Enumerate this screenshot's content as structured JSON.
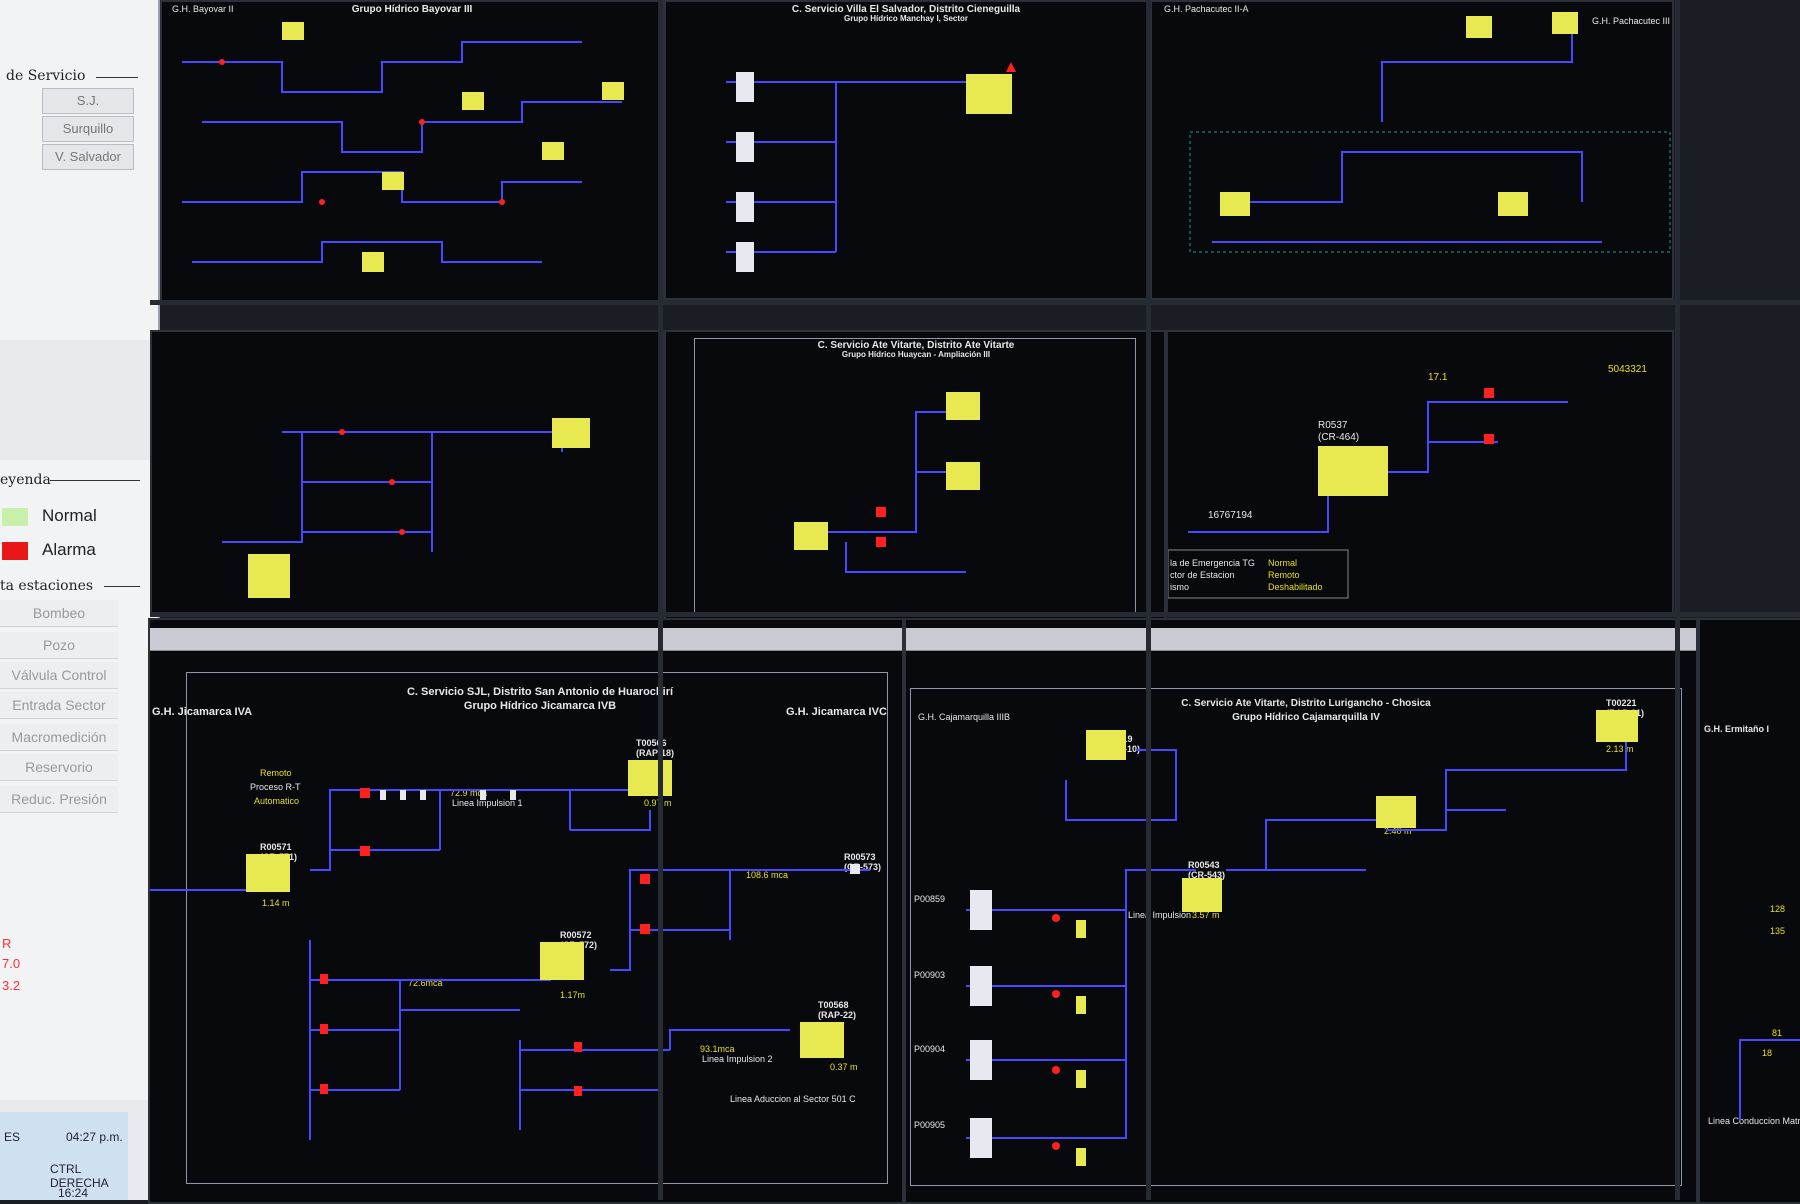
{
  "left_panel": {
    "service_title": "de Servicio",
    "service_buttons": [
      "S.J. Lurigancho",
      "Surquillo",
      "V. Salvador"
    ],
    "legend_title": "eyenda",
    "legend_items": [
      {
        "label": "Normal",
        "color": "#c8f0a8"
      },
      {
        "label": "Alarma",
        "color": "#e81818"
      }
    ],
    "stations_title": "ta estaciones",
    "stations": [
      "Bombeo",
      "Pozo",
      "Válvula Control",
      "Entrada Sector",
      "Macromedición",
      "Reservorio",
      "Reduc. Presión"
    ],
    "red_values": [
      "R",
      "7.0",
      "3.2"
    ],
    "taskbar": {
      "lang": "ES",
      "time": "04:27 p.m.",
      "ctrl": "CTRL DERECHA",
      "clock2": "16:24"
    }
  },
  "screens": {
    "s1": {
      "title": "Grupo Hídrico Bayovar III",
      "left": "G.H. Bayovar II"
    },
    "s2": {
      "title": "C. Servicio Villa El Salvador, Distrito Cieneguilla",
      "sub": "Grupo Hídrico Manchay I, Sector"
    },
    "s3": {
      "left": "G.H. Pachacutec II-A",
      "right": "G.H. Pachacutec III"
    },
    "s5": {
      "title": "C. Servicio Ate Vitarte, Distrito Ate Vitarte",
      "sub": "Grupo Hídrico Huaycan - Ampliación III"
    },
    "s6": {
      "tank": "R0537",
      "tank_code": "(CR-464)",
      "value": "17.1",
      "total": "5043321",
      "flow": "16767194",
      "states": [
        "Normal",
        "Remoto",
        "Deshabilitado"
      ],
      "left_labels": [
        "la de Emergencia TG",
        "ctor de Estacion",
        "ismo"
      ]
    },
    "s7": {
      "title": "C. Servicio SJL, Distrito San Antonio de Huarochirí",
      "sub": "Grupo Hídrico Jicamarca IVB",
      "left": "G.H. Jicamarca IVA",
      "right": "G.H. Jicamarca IVC",
      "labels": {
        "remoto": "Remoto",
        "proceso": "Proceso R-T",
        "auto": "Automatico",
        "tank1": "R00571",
        "tank1_code": "(CR-571)",
        "tank2": "R00572",
        "tank2_code": "(CR-572)",
        "tank3": "T00566",
        "tank3_code": "(RAP-18)",
        "tank4": "T00568",
        "tank4_code": "(RAP-22)",
        "r573": "R00573",
        "r573_code": "(CR-573)",
        "val1": "1.14 m",
        "val2": "1.17m",
        "val3": "0.97 m",
        "val4": "0.37 m",
        "mca1": "72.9 mca",
        "mca2": "108.6 mca",
        "mca3": "72.6mca",
        "mca4": "93.1mca",
        "linea1": "Linea Impulsion 1",
        "linea2": "Linea Impulsion 2",
        "aduccion": "Linea Aduccion al Sector 501 C"
      }
    },
    "s8": {
      "title": "C. Servicio Ate Vitarte, Distrito Lurigancho - Chosica",
      "sub": "Grupo Hídrico Cajamarquilla IV",
      "left": "G.H. Cajamarquilla IIIB",
      "labels": {
        "t219": "T00219",
        "t219_code": "(RAP-10)",
        "r543": "R00543",
        "r543_code": "(CR-543)",
        "val1": "3.57 m",
        "val2": "2.40 m",
        "val3": "2.13 m",
        "linea": "Linea Impulsion",
        "p859": "P00859",
        "p903": "P00903",
        "p904": "P00904",
        "p905": "P00905",
        "t221": "T00221",
        "t221_code": "(RAP-01)"
      }
    },
    "s9": {
      "left": "G.H. Ermitaño I",
      "values": [
        "128",
        "135",
        "81",
        "18"
      ],
      "bottom": "Linea Conduccion Matriz Atarjea"
    }
  }
}
